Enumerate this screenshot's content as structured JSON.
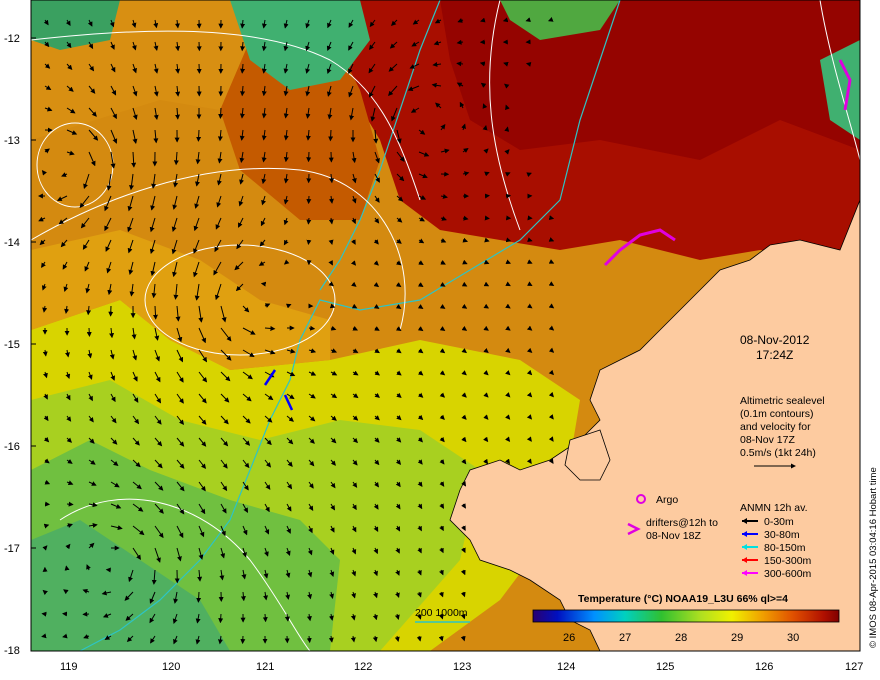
{
  "map": {
    "date": "08-Nov-2012",
    "time": "17:24Z",
    "y_tick_labels": [
      "-12",
      "-13",
      "-14",
      "-15",
      "-16",
      "-17",
      "-18"
    ],
    "x_tick_labels": [
      "119",
      "120",
      "121",
      "122",
      "123",
      "124",
      "125",
      "126",
      "127"
    ],
    "altimetry_note": [
      "Altimetric sealevel",
      "(0.1m contours)",
      "and velocity for",
      "08-Nov 17Z",
      "0.5m/s (1kt 24h)"
    ],
    "argo_label": "Argo",
    "drifters_note": [
      "drifters@12h to",
      "08-Nov 18Z"
    ],
    "anmn_title": "ANMN 12h av.",
    "anmn_depths": [
      {
        "label": "0-30m",
        "color": "#000000"
      },
      {
        "label": "30-80m",
        "color": "#0000ff"
      },
      {
        "label": "80-150m",
        "color": "#00e0e0"
      },
      {
        "label": "150-300m",
        "color": "#ff0000"
      },
      {
        "label": "300-600m",
        "color": "#ff00ff"
      }
    ],
    "isobath_label": "200  1000m",
    "colorbar_title": "Temperature (°C) NOAA19_L3U 66% ql>=4",
    "colorbar_ticks": [
      "26",
      "27",
      "28",
      "29",
      "30"
    ],
    "credit": "© IMOS 08-Apr-2015 03:04:16 Hobart time",
    "colors": {
      "land": "#fdcba0",
      "cold": "#2a0070",
      "warm": "#8b0000",
      "isobath": "#2ec4c4",
      "argo": "#e000e0",
      "contour": "#ffffff"
    }
  }
}
